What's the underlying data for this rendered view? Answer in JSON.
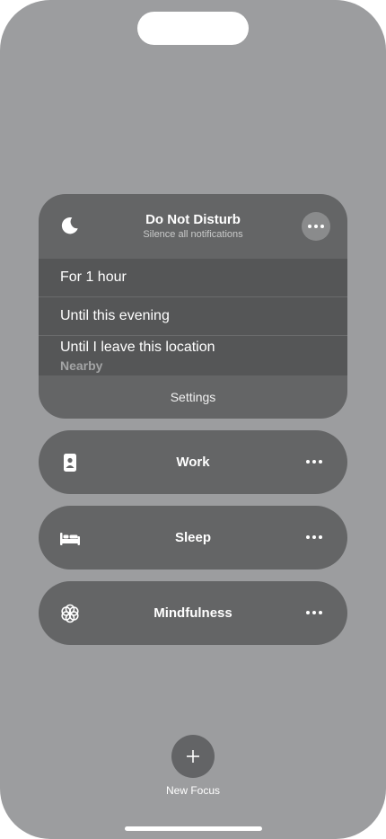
{
  "dnd": {
    "title": "Do Not Disturb",
    "subtitle": "Silence all notifications",
    "icon": "moon-icon",
    "options": [
      {
        "label": "For 1 hour"
      },
      {
        "label": "Until this evening"
      },
      {
        "label": "Until I leave this location",
        "sublabel": "Nearby"
      }
    ],
    "settings_label": "Settings"
  },
  "focus_modes": [
    {
      "label": "Work",
      "icon": "id-badge-icon"
    },
    {
      "label": "Sleep",
      "icon": "bed-icon"
    },
    {
      "label": "Mindfulness",
      "icon": "flower-icon"
    }
  ],
  "new_focus": {
    "label": "New Focus",
    "icon": "plus-icon"
  },
  "colors": {
    "background": "#9c9d9f",
    "card": "#646566",
    "option_row": "#555657",
    "text": "#ffffff"
  }
}
